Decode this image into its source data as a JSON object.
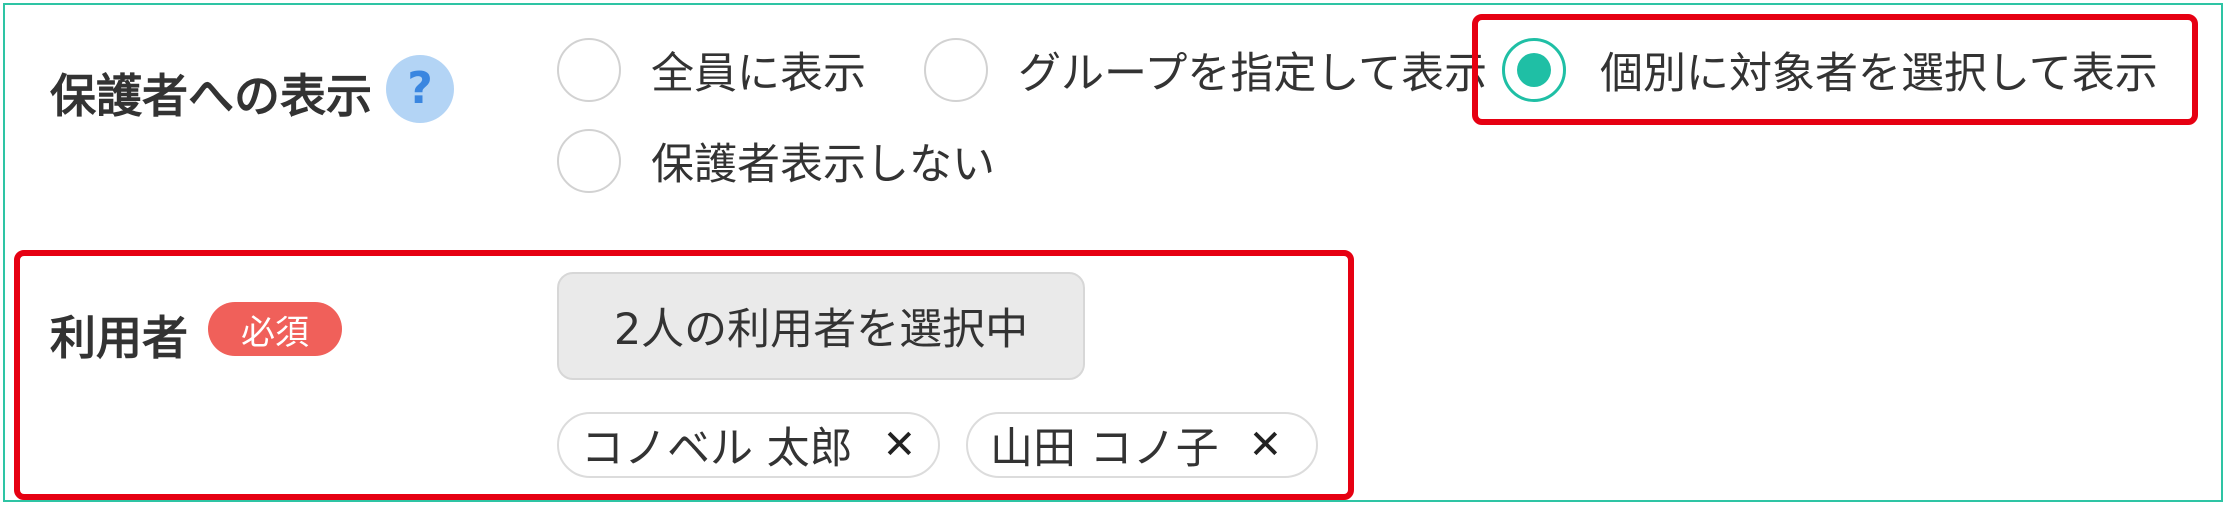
{
  "guardian_display": {
    "label": "保護者への表示",
    "help_icon": "?",
    "options": [
      {
        "label": "全員に表示",
        "selected": false
      },
      {
        "label": "グループを指定して表示",
        "selected": false
      },
      {
        "label": "個別に対象者を選択して表示",
        "selected": true
      },
      {
        "label": "保護者表示しない",
        "selected": false
      }
    ]
  },
  "users": {
    "label": "利用者",
    "required_badge": "必須",
    "select_button": "2人の利用者を選択中",
    "selected_users": [
      {
        "name": "コノベル 太郎",
        "remove": "✕"
      },
      {
        "name": "山田 コノ子",
        "remove": "✕"
      }
    ]
  },
  "colors": {
    "frame_border": "#2ec4a4",
    "radio_selected": "#1fbfa5",
    "highlight_box": "#e60012",
    "required_badge": "#f0605a",
    "help_icon_bg": "#b3d4f5"
  }
}
